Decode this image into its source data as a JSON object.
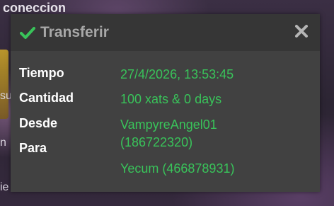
{
  "background": {
    "top_text": "coneccion",
    "left_fragments": [
      "su",
      "n",
      "ie"
    ]
  },
  "dialog": {
    "title": "Transferir",
    "colors": {
      "accent_green": "#39c35a",
      "title_gray": "#a8a8a8",
      "panel": "#414141",
      "header": "#363636"
    },
    "icons": {
      "title": "check-icon",
      "close": "close-icon"
    },
    "rows": [
      {
        "label": "Tiempo",
        "value": "27/4/2026, 13:53:45"
      },
      {
        "label": "Cantidad",
        "value": "100 xats & 0 days"
      },
      {
        "label": "Desde",
        "value": "VampyreAngel01"
      },
      {
        "label": "Para",
        "value": "(186722320)"
      }
    ],
    "extra_value": "Yecum (466878931)"
  }
}
